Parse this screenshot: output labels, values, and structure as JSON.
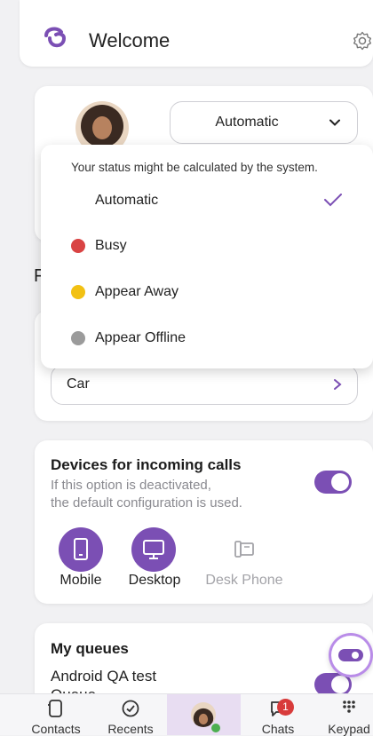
{
  "header": {
    "title": "Welcome"
  },
  "status": {
    "selected": "Automatic",
    "hint": "Your status might be calculated by the system.",
    "options": [
      {
        "label": "Automatic",
        "color": "",
        "checked": true
      },
      {
        "label": "Busy",
        "color": "#d94343"
      },
      {
        "label": "Appear Away",
        "color": "#f2c113"
      },
      {
        "label": "Appear Offline",
        "color": "#9b9b9b"
      }
    ]
  },
  "location": {
    "partial_label": "F",
    "value": "Car"
  },
  "devices": {
    "title": "Devices for incoming calls",
    "subtitle_line1": "If this option is deactivated,",
    "subtitle_line2": "the default configuration is used.",
    "items": [
      {
        "label": "Mobile",
        "active": true
      },
      {
        "label": "Desktop",
        "active": true
      },
      {
        "label": "Desk Phone",
        "active": false
      }
    ]
  },
  "queues": {
    "title": "My queues",
    "item_line1": "Android QA test",
    "item_line2": "Queue"
  },
  "tabbar": {
    "tabs": [
      {
        "label": "Contacts"
      },
      {
        "label": "Recents"
      },
      {
        "label": ""
      },
      {
        "label": "Chats"
      },
      {
        "label": "Keypad"
      }
    ],
    "chats_badge": "1"
  },
  "colors": {
    "accent": "#7b4fb4"
  }
}
